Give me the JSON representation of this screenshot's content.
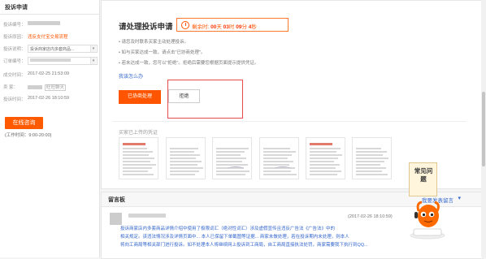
{
  "left": {
    "title": "投诉申请",
    "rows": [
      {
        "label": "投诉编号：",
        "value": "",
        "masked": true
      },
      {
        "label": "投诉原因：",
        "value": "违反支付宝交易流程",
        "highlight": true
      },
      {
        "label": "投诉说明：",
        "value": "投诉商家店内多套商品...",
        "select": true
      },
      {
        "label": "订单编号：",
        "value": "",
        "select": true,
        "masked": true
      },
      {
        "label": "成交时间：",
        "value": "2017-02-25 21:53:09"
      },
      {
        "label": "卖 家：",
        "value": "旺旺聊天",
        "masked": true
      },
      {
        "label": "投诉时间：",
        "value": "2017-02-26 18:10:59"
      }
    ],
    "consult_button": "在线咨询",
    "hours": "(工作时间：9:00-20:00)"
  },
  "main": {
    "heading": "请处理投诉申请",
    "timer_label": "剩余时:",
    "timer_days": "00",
    "timer_days_unit": "天",
    "timer_hours": "03",
    "timer_hours_unit": "时",
    "timer_minutes": "09",
    "timer_minutes_unit": "分",
    "timer_seconds": "4",
    "timer_seconds_unit": "秒",
    "tips": [
      "• 请您及时联系买家主动处理投诉。",
      "• 如与买家达成一致，请点击\"已协商处理\"。",
      "• 若未达成一致，您可以\"拒绝\"。拒绝后需要您根据页面提示提供凭证。"
    ],
    "learn_link": "我该怎么办",
    "agree_button": "已协商处理",
    "refuse_button": "拒绝",
    "evidence_title": "买家已上传的凭证",
    "evidence_count": 6
  },
  "board": {
    "title": "留言板",
    "post_link": "我要发表留言",
    "message_time": "(2017-02-26 18:10:59)",
    "message_lines": [
      "投诉商家店内多套商品详情介绍中使用了极限词汇（绝对性词汇）涉及虚假宣传且违反广告法《广告法》中的",
      "相关规定。该违法情况涉及详情页面中... 本人已保留下单截图等证据... 商家未做处理，若在投诉期内未处理，则本人",
      "将向工商局等相关部门进行投诉。如不处理本人将继续网上投诉到工商局，自工商局直接执法处罚，商家需要我下执行到QQ..."
    ]
  },
  "faq": {
    "label": "常见问题"
  },
  "colors": {
    "accent": "#ff5500",
    "link": "#3366cc",
    "highlight_box": "#e94a4a"
  }
}
